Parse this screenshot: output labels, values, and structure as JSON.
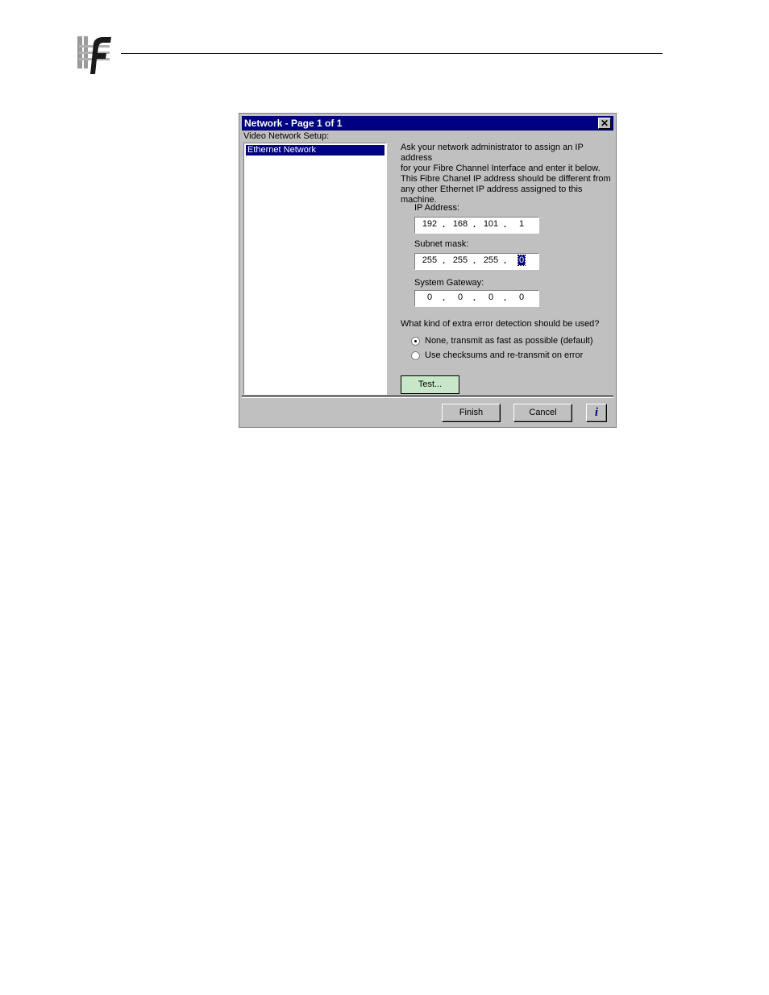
{
  "dialog": {
    "title": "Network - Page 1 of 1",
    "close_glyph": "✕",
    "list_label": "Video Network Setup:",
    "list_items": [
      "Ethernet Network"
    ],
    "description_lines": [
      "Ask your network administrator to assign an IP address",
      "for your Fibre Channel Interface and enter it below.",
      "This Fibre Chanel IP address should be different from",
      "any other Ethernet IP address assigned to this",
      "machine."
    ],
    "ip_address": {
      "label": "IP Address:",
      "octets": [
        "192",
        "168",
        "101",
        "1"
      ]
    },
    "subnet_mask": {
      "label": "Subnet mask:",
      "octets": [
        "255",
        "255",
        "255",
        "0"
      ]
    },
    "gateway": {
      "label": "System Gateway:",
      "octets": [
        "0",
        "0",
        "0",
        "0"
      ]
    },
    "error_question": "What kind of extra error detection should be used?",
    "radio_options": [
      {
        "label": "None, transmit as fast as possible (default)",
        "checked": true
      },
      {
        "label": "Use checksums and re-transmit on error",
        "checked": false
      }
    ],
    "test_button": "Test...",
    "finish_button": "Finish",
    "cancel_button": "Cancel",
    "info_button": "i"
  }
}
